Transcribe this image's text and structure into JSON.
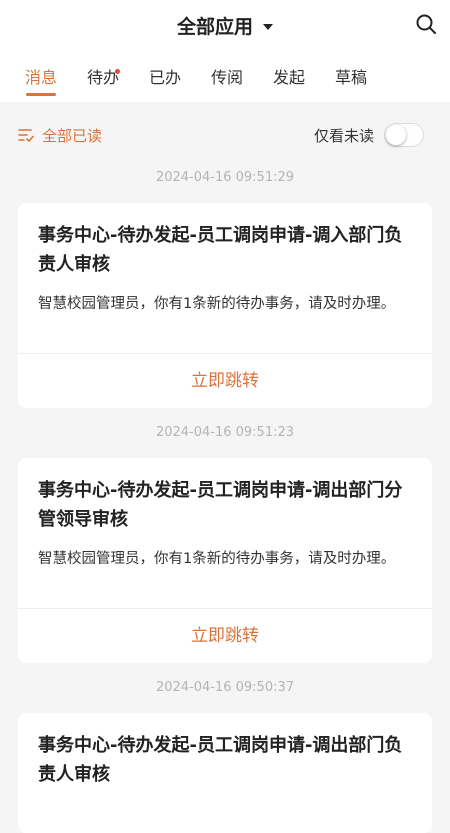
{
  "header": {
    "title": "全部应用",
    "caret_icon": "caret-down-icon",
    "search_icon": "search-icon"
  },
  "tabs": [
    {
      "label": "消息",
      "active": true
    },
    {
      "label": "待办",
      "badge": "red-dot"
    },
    {
      "label": "已办"
    },
    {
      "label": "传阅"
    },
    {
      "label": "发起"
    },
    {
      "label": "草稿"
    }
  ],
  "toolbar": {
    "read_all_label": "全部已读",
    "read_all_icon": "list-filter-icon",
    "unread_only_label": "仅看未读",
    "unread_only_on": false
  },
  "messages": [
    {
      "time": "2024-04-16 09:51:29",
      "title": "事务中心-待办发起-员工调岗申请-调入部门负责人审核",
      "body": "智慧校园管理员，你有1条新的待办事务，请及时办理。",
      "action": "立即跳转"
    },
    {
      "time": "2024-04-16 09:51:23",
      "title": "事务中心-待办发起-员工调岗申请-调出部门分管领导审核",
      "body": "智慧校园管理员，你有1条新的待办事务，请及时办理。",
      "action": "立即跳转"
    },
    {
      "time": "2024-04-16 09:50:37",
      "title": "事务中心-待办发起-员工调岗申请-调出部门负责人审核",
      "body": "",
      "action": ""
    }
  ],
  "colors": {
    "accent": "#d9733c",
    "badge": "#e0493f",
    "background": "#f5f5f5"
  }
}
